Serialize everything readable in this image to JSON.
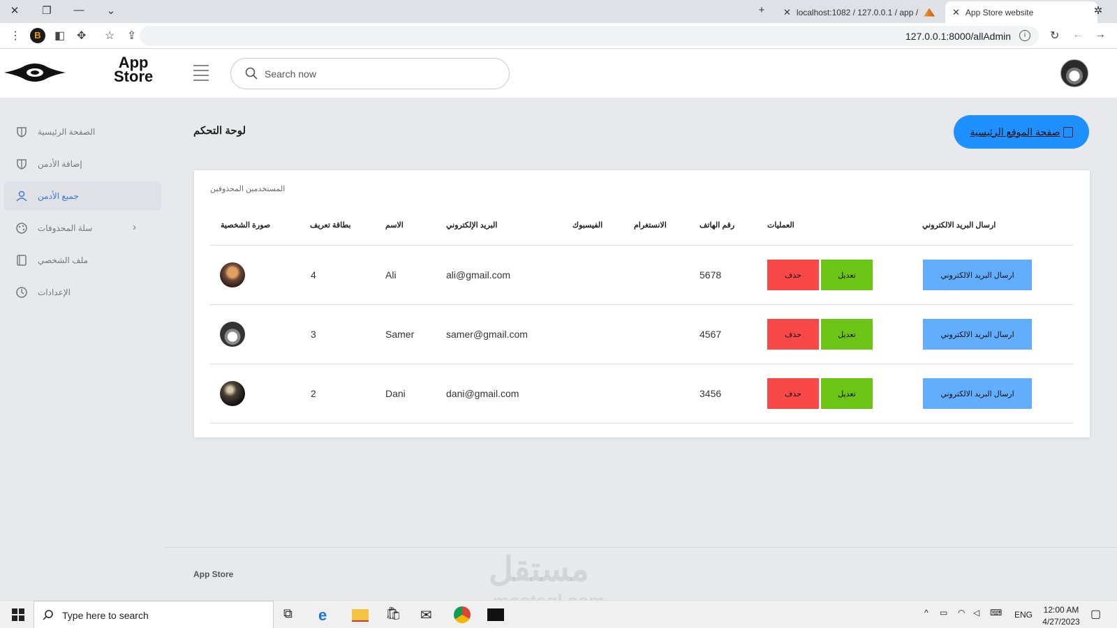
{
  "browser": {
    "tabs": [
      {
        "label": "localhost:1082 / 127.0.0.1 / app /"
      },
      {
        "label": "App Store website"
      }
    ],
    "url": "127.0.0.1:8000/allAdmin"
  },
  "header": {
    "brand_line1": "App",
    "brand_line2": "Store",
    "search_placeholder": "Search now"
  },
  "sidebar": {
    "items": [
      {
        "label": "الصفحة الرئيسية",
        "icon": "shield-icon"
      },
      {
        "label": "إضافة الأدمن",
        "icon": "shield-icon"
      },
      {
        "label": "جميع الأدمن",
        "icon": "user-icon"
      },
      {
        "label": "سلة المحذوفات",
        "icon": "palette-icon"
      },
      {
        "label": "ملف الشخصي",
        "icon": "book-icon"
      },
      {
        "label": "الإعدادات",
        "icon": "clock-icon"
      }
    ]
  },
  "page": {
    "title": "لوحة التحكم",
    "home_button": "صفحة الموقع الرئيسية"
  },
  "table": {
    "caption": "المستخدمين المحذوفين",
    "headers": {
      "photo": "صورة الشخصية",
      "id_card": "بطاقة تعريف",
      "name": "الاسم",
      "email": "البريد الإلكتروني",
      "facebook": "الفيسبوك",
      "instagram": "الانستغرام",
      "phone": "رقم الهاتف",
      "operations": "العمليات",
      "send_email": "ارسال البريد الالكتروني"
    },
    "rows": [
      {
        "id": "4",
        "name": "Ali",
        "email": "ali@gmail.com",
        "phone": "5678",
        "edit": "تعديل",
        "delete": "حذف",
        "send": "ارسال البريد الالكتروني"
      },
      {
        "id": "3",
        "name": "Samer",
        "email": "samer@gmail.com",
        "phone": "4567",
        "edit": "تعديل",
        "delete": "حذف",
        "send": "ارسال البريد الالكتروني"
      },
      {
        "id": "2",
        "name": "Dani",
        "email": "dani@gmail.com",
        "phone": "3456",
        "edit": "تعديل",
        "delete": "حذف",
        "send": "ارسال البريد الالكتروني"
      }
    ]
  },
  "footer": {
    "text": "App Store"
  },
  "watermark": {
    "line1": "مستقل",
    "line2": "mostaql.com"
  },
  "taskbar": {
    "search_placeholder": "Type here to search",
    "lang": "ENG",
    "time": "12:00 AM",
    "date": "4/27/2023"
  },
  "colors": {
    "primary": "#1e90ff",
    "delete": "#f94848",
    "edit": "#6cc417",
    "mail": "#63aefc",
    "active_link": "#3a7bd5"
  }
}
